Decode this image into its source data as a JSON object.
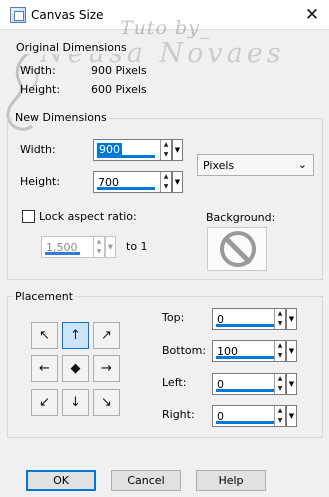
{
  "window": {
    "title": "Canvas Size",
    "close_glyph": "✕",
    "icon": "canvas-size-app-icon"
  },
  "watermark": {
    "line1": "Tuto by_",
    "line2": "Neusa Novaes"
  },
  "original_dimensions": {
    "legend": "Original Dimensions",
    "width_label": "Width:",
    "width_value": "900 Pixels",
    "height_label": "Height:",
    "height_value": "600 Pixels"
  },
  "new_dimensions": {
    "legend": "New Dimensions",
    "width_label": "Width:",
    "width_value": "900",
    "height_label": "Height:",
    "height_value": "700",
    "units_value": "Pixels",
    "lock_label": "Lock aspect ratio:",
    "lock_checked": false,
    "ratio_value": "1,500",
    "ratio_suffix": "to 1",
    "background_label": "Background:"
  },
  "placement": {
    "legend": "Placement",
    "anchors": [
      "↖",
      "↑",
      "↗",
      "←",
      "◆",
      "→",
      "↙",
      "↓",
      "↘"
    ],
    "active_anchor": "top-center",
    "top_label": "Top:",
    "top_value": "0",
    "bottom_label": "Bottom:",
    "bottom_value": "100",
    "left_label": "Left:",
    "left_value": "0",
    "right_label": "Right:",
    "right_value": "0"
  },
  "buttons": {
    "ok": "OK",
    "cancel": "Cancel",
    "help": "Help"
  },
  "colors": {
    "accent": "#0078d7",
    "active_anchor_bg": "#cce4f7",
    "dialog_bg": "#f0f0f0"
  }
}
